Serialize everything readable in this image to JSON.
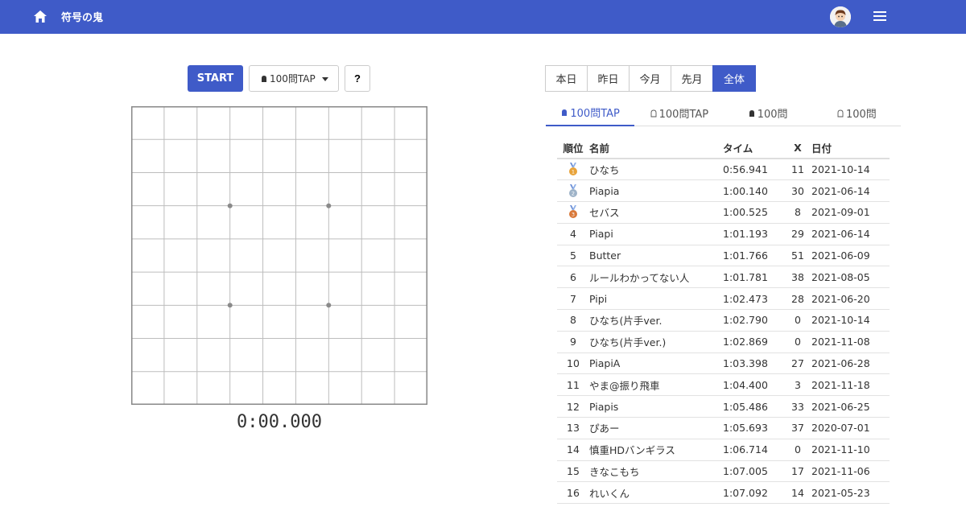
{
  "header": {
    "title": "符号の鬼",
    "home_icon": "home-icon",
    "menu_icon": "hamburger-menu-icon",
    "accent": "#3f5bc8"
  },
  "controls": {
    "start_label": "START",
    "mode_label": "100問TAP",
    "help_label": "?"
  },
  "timer": "0:00.000",
  "period_tabs": [
    {
      "label": "本日",
      "active": false
    },
    {
      "label": "昨日",
      "active": false
    },
    {
      "label": "今月",
      "active": false
    },
    {
      "label": "先月",
      "active": false
    },
    {
      "label": "全体",
      "active": true
    }
  ],
  "category_tabs": [
    {
      "label": "100問TAP",
      "icon": "filled-bell-icon",
      "active": true
    },
    {
      "label": "100問TAP",
      "icon": "outline-bell-icon",
      "active": false
    },
    {
      "label": "100問",
      "icon": "filled-bell-icon",
      "active": false
    },
    {
      "label": "100問",
      "icon": "outline-bell-icon",
      "active": false
    }
  ],
  "ranking": {
    "headers": {
      "rank": "順位",
      "name": "名前",
      "time": "タイム",
      "x": "X",
      "date": "日付"
    },
    "rows": [
      {
        "rank": "1",
        "medal": "gold",
        "name": "ひなち",
        "time": "0:56.941",
        "x": "11",
        "date": "2021-10-14"
      },
      {
        "rank": "2",
        "medal": "silver",
        "name": "Piapia",
        "time": "1:00.140",
        "x": "30",
        "date": "2021-06-14"
      },
      {
        "rank": "3",
        "medal": "bronze",
        "name": "セバス",
        "time": "1:00.525",
        "x": "8",
        "date": "2021-09-01"
      },
      {
        "rank": "4",
        "medal": "",
        "name": "Piapi",
        "time": "1:01.193",
        "x": "29",
        "date": "2021-06-14"
      },
      {
        "rank": "5",
        "medal": "",
        "name": "Butter",
        "time": "1:01.766",
        "x": "51",
        "date": "2021-06-09"
      },
      {
        "rank": "6",
        "medal": "",
        "name": "ルールわかってない人",
        "time": "1:01.781",
        "x": "38",
        "date": "2021-08-05"
      },
      {
        "rank": "7",
        "medal": "",
        "name": "Pipi",
        "time": "1:02.473",
        "x": "28",
        "date": "2021-06-20"
      },
      {
        "rank": "8",
        "medal": "",
        "name": "ひなち(片手ver.",
        "time": "1:02.790",
        "x": "0",
        "date": "2021-10-14"
      },
      {
        "rank": "9",
        "medal": "",
        "name": "ひなち(片手ver.)",
        "time": "1:02.869",
        "x": "0",
        "date": "2021-11-08"
      },
      {
        "rank": "10",
        "medal": "",
        "name": "PiapiA",
        "time": "1:03.398",
        "x": "27",
        "date": "2021-06-28"
      },
      {
        "rank": "11",
        "medal": "",
        "name": "やま@振り飛車",
        "time": "1:04.400",
        "x": "3",
        "date": "2021-11-18"
      },
      {
        "rank": "12",
        "medal": "",
        "name": "Piapis",
        "time": "1:05.486",
        "x": "33",
        "date": "2021-06-25"
      },
      {
        "rank": "13",
        "medal": "",
        "name": "ぴあー",
        "time": "1:05.693",
        "x": "37",
        "date": "2020-07-01"
      },
      {
        "rank": "14",
        "medal": "",
        "name": "慎重HDバンギラス",
        "time": "1:06.714",
        "x": "0",
        "date": "2021-11-10"
      },
      {
        "rank": "15",
        "medal": "",
        "name": "きなこもち",
        "time": "1:07.005",
        "x": "17",
        "date": "2021-11-06"
      },
      {
        "rank": "16",
        "medal": "",
        "name": "れいくん",
        "time": "1:07.092",
        "x": "14",
        "date": "2021-05-23"
      }
    ]
  }
}
